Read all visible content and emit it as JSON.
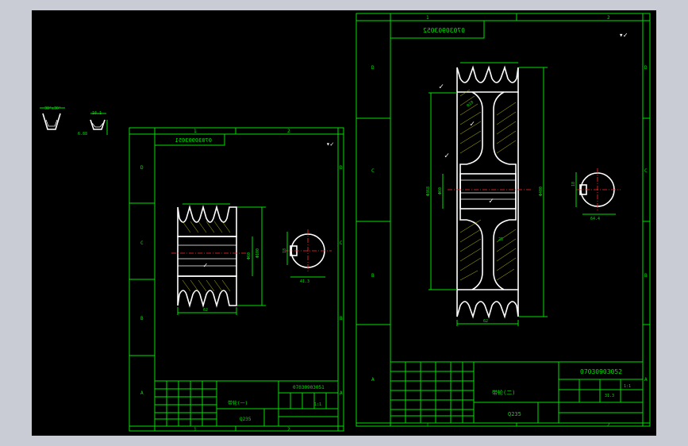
{
  "drawing_left": {
    "code": "07030903051",
    "code_mirrored": "07030903051",
    "title": "带轮(一)",
    "material": "Q235",
    "scale": "1:1",
    "zone_letters": [
      "D",
      "C",
      "B",
      "A"
    ],
    "zone_numbers": [
      "1",
      "2"
    ],
    "dims": {
      "width": "62",
      "hub": "Φ60",
      "outer": "Φ100",
      "key_width": "18",
      "key_depth": "41.3"
    }
  },
  "drawing_right": {
    "code": "07030903052",
    "code_mirrored": "07030903052",
    "title": "带轮(二)",
    "material": "Q235",
    "mass": "31.3",
    "scale": "1:1",
    "zone_letters": [
      "D",
      "C",
      "B",
      "A"
    ],
    "zone_numbers": [
      "1",
      "2"
    ],
    "dims": {
      "width": "62",
      "outer": "Φ400",
      "pitch": "Φ368",
      "bore": "Φ60",
      "key_width": "18",
      "key_depth": "64.4",
      "rim": "R10",
      "web": "25"
    }
  },
  "groove_detail": {
    "angle": "38°±30'",
    "width": "16.1",
    "depth": "6.88"
  },
  "colors": {
    "frame": "#00e000",
    "geometry": "#ffffff",
    "centerline": "#ff2a2a",
    "hatch": "#c8c800",
    "background": "#000000"
  }
}
